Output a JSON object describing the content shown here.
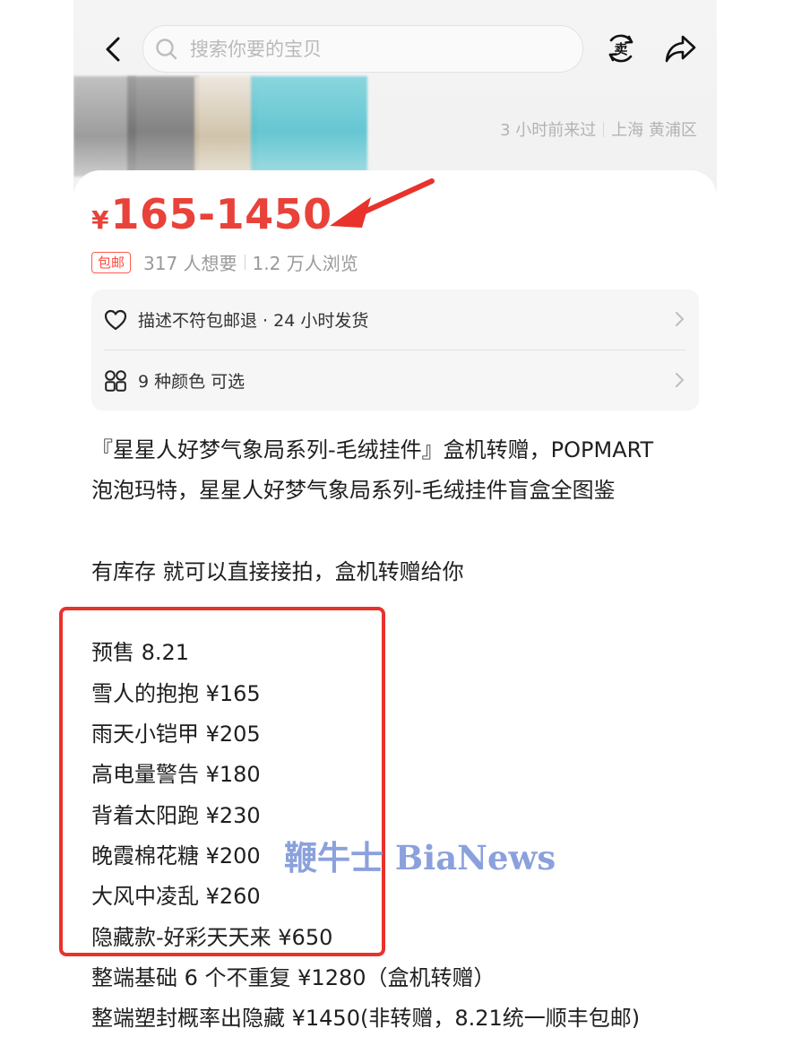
{
  "search": {
    "placeholder": "搜索你要的宝贝"
  },
  "status": {
    "last_seen": "3 小时前来过",
    "location": "上海 黄浦区"
  },
  "price": {
    "currency": "¥",
    "range": "165-1450"
  },
  "meta": {
    "badge": "包邮",
    "wants": "317 人想要",
    "views": "1.2 万人浏览"
  },
  "services": [
    {
      "icon": "heart-icon",
      "text": "描述不符包邮退 · 24 小时发货"
    },
    {
      "icon": "grid-icon",
      "text": "9 种颜色 可选"
    }
  ],
  "description": [
    "『星星人好梦气象局系列-毛绒挂件』盒机转赠，POPMART",
    "泡泡玛特，星星人好梦气象局系列-毛绒挂件盲盒全图鉴",
    "",
    "有库存 就可以直接接拍，盒机转赠给你",
    "",
    "预售 8.21",
    "雪人的抱抱 ¥165",
    "雨天小铠甲 ¥205",
    "高电量警告 ¥180",
    "背着太阳跑 ¥230",
    "晚霞棉花糖 ¥200",
    "大风中凌乱 ¥260",
    "隐藏款-好彩天天来 ¥650",
    "整端基础 6 个不重复 ¥1280（盒机转赠）",
    "整端塑封概率出隐藏 ¥1450(非转赠，8.21统一顺丰包邮)"
  ],
  "watermark": "鞭牛士 BiaNews",
  "colors": {
    "price": "#e8423a",
    "highlight_box": "#e8322c",
    "watermark": "#7f97d9"
  }
}
